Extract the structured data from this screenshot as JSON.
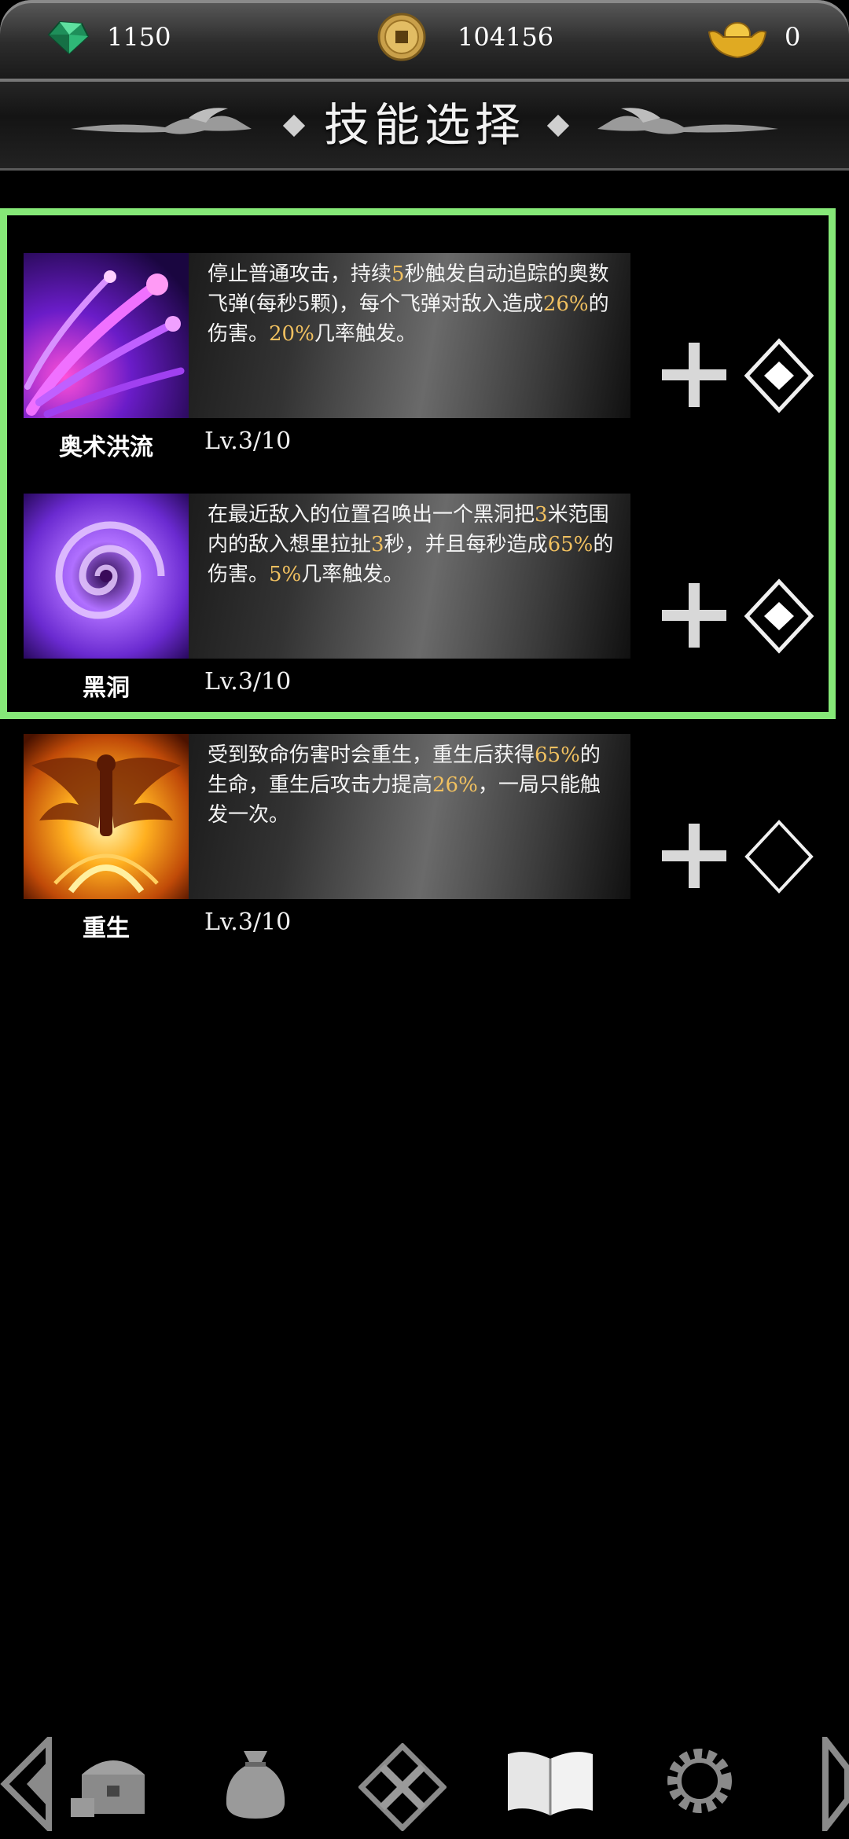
{
  "currency": {
    "gems": "1150",
    "coins": "104156",
    "ingots": "0"
  },
  "header": {
    "title": "技能选择"
  },
  "skills": [
    {
      "name": "奥术洪流",
      "level": "Lv.3/10",
      "icon": "arcane-torrent-icon",
      "desc_parts": [
        {
          "t": "停止普通攻击，持续",
          "hl": false
        },
        {
          "t": "5",
          "hl": true
        },
        {
          "t": "秒触发自动追踪的奥数飞弹(每秒5颗)，每个飞弹对敌入造成",
          "hl": false
        },
        {
          "t": "26%",
          "hl": true
        },
        {
          "t": "的伤害。",
          "hl": false
        },
        {
          "t": "20%",
          "hl": true
        },
        {
          "t": "几率触发。",
          "hl": false
        }
      ]
    },
    {
      "name": "黑洞",
      "level": "Lv.3/10",
      "icon": "black-hole-icon",
      "desc_parts": [
        {
          "t": "在最近敌入的位置召唤出一个黑洞把",
          "hl": false
        },
        {
          "t": "3",
          "hl": true
        },
        {
          "t": "米范围内的敌入想里拉扯",
          "hl": false
        },
        {
          "t": "3",
          "hl": true
        },
        {
          "t": "秒，并且每秒造成",
          "hl": false
        },
        {
          "t": "65%",
          "hl": true
        },
        {
          "t": "的伤害。",
          "hl": false
        },
        {
          "t": "5%",
          "hl": true
        },
        {
          "t": "几率触发。",
          "hl": false
        }
      ]
    },
    {
      "name": "重生",
      "level": "Lv.3/10",
      "icon": "rebirth-icon",
      "desc_parts": [
        {
          "t": "受到致命伤害时会重生，重生后获得",
          "hl": false
        },
        {
          "t": "65%",
          "hl": true
        },
        {
          "t": "的生命，重生后攻击力提高",
          "hl": false
        },
        {
          "t": "26%",
          "hl": true
        },
        {
          "t": "，一局只能触发一次。",
          "hl": false
        }
      ]
    }
  ],
  "nav": [
    "treasure-chest-icon",
    "money-bag-icon",
    "crossed-swords-icon",
    "skill-book-icon",
    "gear-icon"
  ],
  "colors": {
    "highlight_border": "#86e878",
    "value_highlight": "#f0c060"
  }
}
